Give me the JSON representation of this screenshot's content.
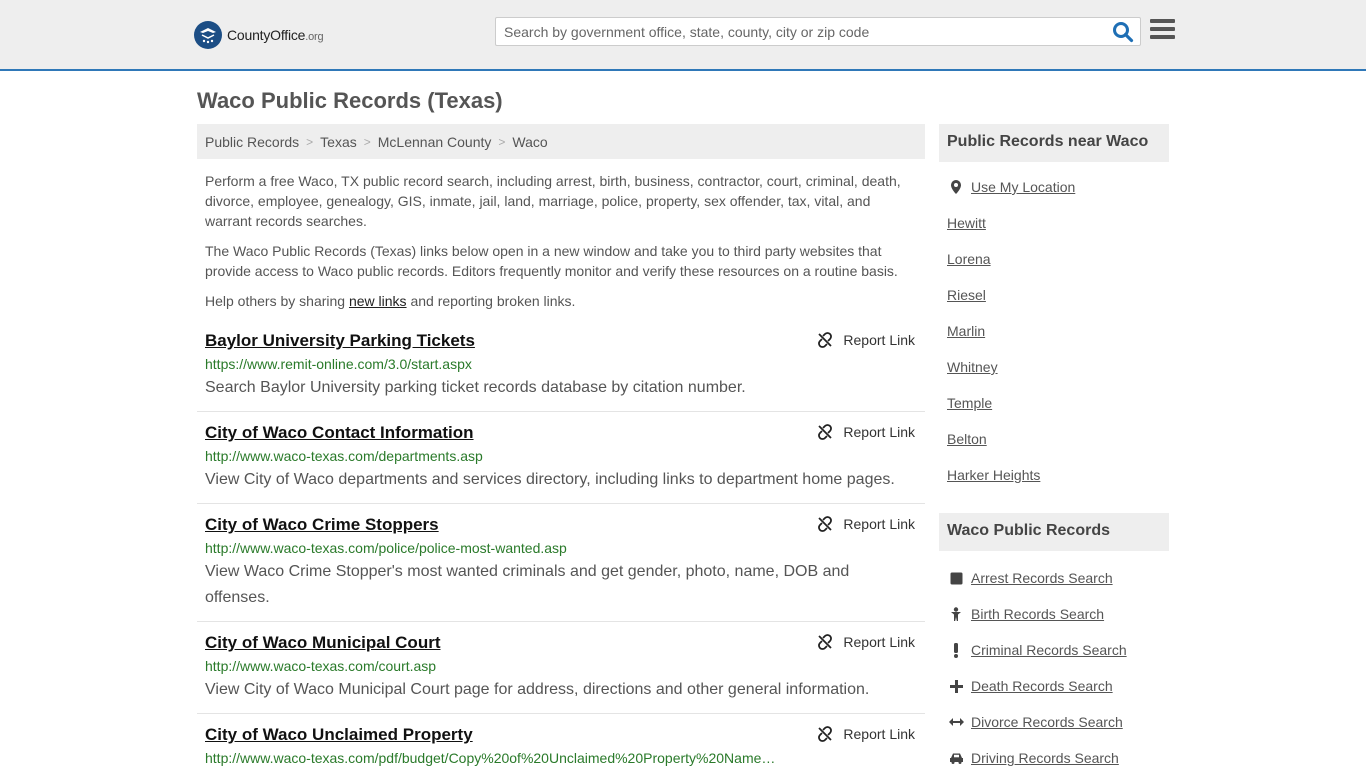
{
  "header": {
    "logo_name": "CountyOffice",
    "logo_tld": ".org",
    "search_placeholder": "Search by government office, state, county, city or zip code"
  },
  "page_title": "Waco Public Records (Texas)",
  "breadcrumb": [
    "Public Records",
    "Texas",
    "McLennan County",
    "Waco"
  ],
  "intro": {
    "p1": "Perform a free Waco, TX public record search, including arrest, birth, business, contractor, court, criminal, death, divorce, employee, genealogy, GIS, inmate, jail, land, marriage, police, property, sex offender, tax, vital, and warrant records searches.",
    "p2": "The Waco Public Records (Texas) links below open in a new window and take you to third party websites that provide access to Waco public records. Editors frequently monitor and verify these resources on a routine basis.",
    "p3_before": "Help others by sharing ",
    "p3_link": "new links",
    "p3_after": " and reporting broken links."
  },
  "report_label": "Report Link",
  "listings": [
    {
      "title": "Baylor University Parking Tickets",
      "url": "https://www.remit-online.com/3.0/start.aspx",
      "desc": "Search Baylor University parking ticket records database by citation number."
    },
    {
      "title": "City of Waco Contact Information",
      "url": "http://www.waco-texas.com/departments.asp",
      "desc": "View City of Waco departments and services directory, including links to department home pages."
    },
    {
      "title": "City of Waco Crime Stoppers",
      "url": "http://www.waco-texas.com/police/police-most-wanted.asp",
      "desc": "View Waco Crime Stopper's most wanted criminals and get gender, photo, name, DOB and offenses."
    },
    {
      "title": "City of Waco Municipal Court",
      "url": "http://www.waco-texas.com/court.asp",
      "desc": "View City of Waco Municipal Court page for address, directions and other general information."
    },
    {
      "title": "City of Waco Unclaimed Property",
      "url": "http://www.waco-texas.com/pdf/budget/Copy%20of%20Unclaimed%20Property%20Name…",
      "desc": ""
    }
  ],
  "sidebar": {
    "near_title": "Public Records near Waco",
    "use_location": "Use My Location",
    "near_cities": [
      "Hewitt",
      "Lorena",
      "Riesel",
      "Marlin",
      "Whitney",
      "Temple",
      "Belton",
      "Harker Heights"
    ],
    "records_title": "Waco Public Records",
    "records": [
      {
        "label": "Arrest Records Search",
        "icon": "square-icon"
      },
      {
        "label": "Birth Records Search",
        "icon": "baby-icon"
      },
      {
        "label": "Criminal Records Search",
        "icon": "exclamation-icon"
      },
      {
        "label": "Death Records Search",
        "icon": "cross-icon"
      },
      {
        "label": "Divorce Records Search",
        "icon": "arrows-h-icon"
      },
      {
        "label": "Driving Records Search",
        "icon": "car-icon"
      }
    ]
  },
  "colors": {
    "accent": "#2f78b8",
    "url_green": "#2a7a2a",
    "header_bg": "#eeeeee"
  }
}
